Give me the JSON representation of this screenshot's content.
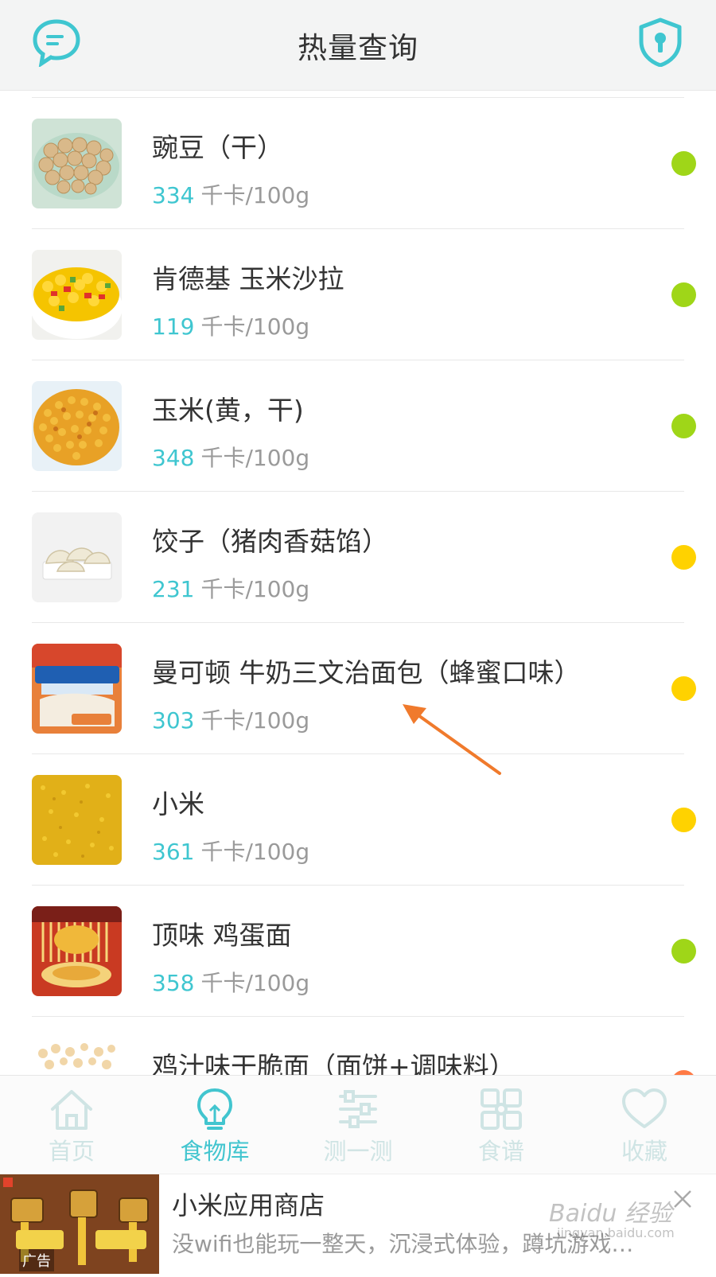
{
  "header": {
    "title": "热量查询",
    "left_icon": "chat-bubble-icon",
    "right_icon": "shield-keyhole-icon",
    "accent": "#3fc6d0"
  },
  "foods": [
    {
      "name": "豌豆（干）",
      "calories": "334",
      "unit": "千卡/100g",
      "dot_color": "#9fd618",
      "image": "chickpeas"
    },
    {
      "name": "肯德基 玉米沙拉",
      "calories": "119",
      "unit": "千卡/100g",
      "dot_color": "#9fd618",
      "image": "corn-salad"
    },
    {
      "name": "玉米(黄，干)",
      "calories": "348",
      "unit": "千卡/100g",
      "dot_color": "#9fd618",
      "image": "corn-kernels"
    },
    {
      "name": "饺子（猪肉香菇馅）",
      "calories": "231",
      "unit": "千卡/100g",
      "dot_color": "#ffd200",
      "image": "dumplings"
    },
    {
      "name": "曼可顿 牛奶三文治面包（蜂蜜口味）",
      "calories": "303",
      "unit": "千卡/100g",
      "dot_color": "#ffd200",
      "image": "bread-package"
    },
    {
      "name": "小米",
      "calories": "361",
      "unit": "千卡/100g",
      "dot_color": "#ffd200",
      "image": "millet"
    },
    {
      "name": "顶味 鸡蛋面",
      "calories": "358",
      "unit": "千卡/100g",
      "dot_color": "#9fd618",
      "image": "egg-noodles"
    },
    {
      "name": "鸡汁味干脆面（面饼+调味料）",
      "calories": "",
      "unit": "",
      "dot_color": "#ff7a45",
      "image": "crispy-noodles"
    }
  ],
  "bottom_nav": [
    {
      "label": "首页",
      "icon": "home-icon",
      "active": false
    },
    {
      "label": "食物库",
      "icon": "lightbulb-icon",
      "active": true
    },
    {
      "label": "测一测",
      "icon": "sliders-icon",
      "active": false
    },
    {
      "label": "食谱",
      "icon": "grid-icon",
      "active": false
    },
    {
      "label": "收藏",
      "icon": "heart-icon",
      "active": false
    }
  ],
  "ad": {
    "title": "小米应用商店",
    "description": "没wifi也能玩一整天，沉浸式体验，蹲坑游戏…",
    "label": "广告",
    "close_icon": "close-icon"
  },
  "watermark": {
    "text": "Baidu 经验",
    "sub": "jingyan.baidu.com"
  }
}
